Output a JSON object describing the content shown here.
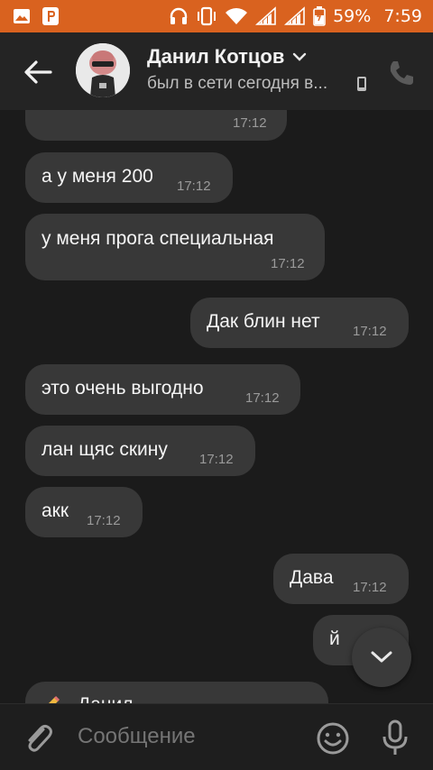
{
  "status_bar": {
    "battery": "59%",
    "time": "7:59"
  },
  "header": {
    "contact_name": "Данил Котцов",
    "status": "был в сети сегодня в..."
  },
  "messages": [
    {
      "text": "",
      "time": "17:12",
      "side": "in"
    },
    {
      "text": "а у меня 200",
      "time": "17:12",
      "side": "in"
    },
    {
      "text": "у меня прога специальная",
      "time": "17:12",
      "side": "in"
    },
    {
      "text": "Дак блин нет",
      "time": "17:12",
      "side": "out"
    },
    {
      "text": "это очень выгодно",
      "time": "17:12",
      "side": "in"
    },
    {
      "text": "лан щяс скину",
      "time": "17:12",
      "side": "in"
    },
    {
      "text": "акк",
      "time": "17:12",
      "side": "in"
    },
    {
      "text": "Дава",
      "time": "17:12",
      "side": "out"
    },
    {
      "text": "й",
      "time": "",
      "side": "out"
    },
    {
      "text": "Данил",
      "time": "",
      "side": "in"
    }
  ],
  "input": {
    "placeholder": "Сообщение"
  },
  "colors": {
    "status_bar": "#d9621f",
    "header_bg": "#242424",
    "chat_bg": "#1b1b1b",
    "bubble": "#383838"
  },
  "icons": [
    "back-arrow-icon",
    "chevron-down-icon",
    "phone-icon",
    "attach-icon",
    "emoji-icon",
    "mic-icon",
    "scroll-down-icon"
  ]
}
